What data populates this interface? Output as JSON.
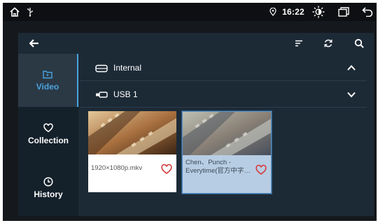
{
  "status_bar": {
    "left_icons": [
      "home-icon",
      "usb-icon"
    ],
    "time": "16:22",
    "right_icons": [
      "location-icon",
      "brightness-icon",
      "recent-apps-icon",
      "back-icon"
    ]
  },
  "toolbar": {
    "left_icon": "back-arrow-icon",
    "right_icons": [
      "sort-icon",
      "refresh-icon",
      "search-icon"
    ]
  },
  "sidebar": {
    "items": [
      {
        "label": "Video",
        "icon": "video-folder-icon",
        "active": true
      },
      {
        "label": "Collection",
        "icon": "heart-icon",
        "active": false
      },
      {
        "label": "History",
        "icon": "clock-icon",
        "active": false
      }
    ]
  },
  "sources": [
    {
      "label": "Internal",
      "icon": "drive-icon",
      "expanded": true
    },
    {
      "label": "USB 1",
      "icon": "usb-drive-icon",
      "expanded": false
    }
  ],
  "files": [
    {
      "name": "1920×1080p.mkv",
      "favorite_icon": "heart-outline-icon",
      "selected": false
    },
    {
      "name_line1": "Chen、Punch -",
      "name_line2": "Everytime(官方中字…",
      "favorite_icon": "heart-outline-icon",
      "selected": true
    }
  ],
  "colors": {
    "accent": "#4aa3df",
    "panel": "#1c2a36",
    "sidebar": "#14202a",
    "favorite": "#d63a3a",
    "selected_card": "#b7cde3"
  }
}
